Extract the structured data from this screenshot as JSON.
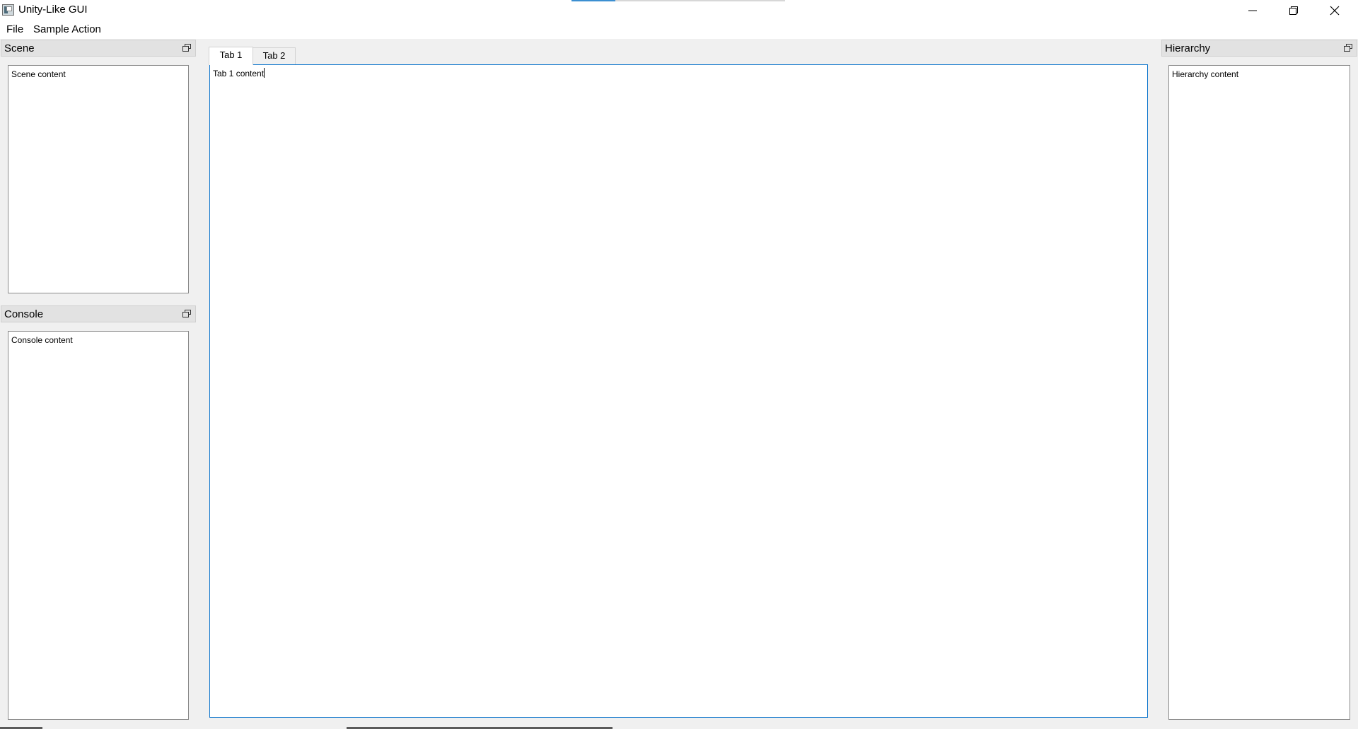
{
  "window": {
    "title": "Unity-Like GUI",
    "icon": "app-icon",
    "controls": [
      "minimize-icon",
      "restore-icon",
      "close-icon"
    ]
  },
  "menubar": {
    "items": [
      {
        "label": "File"
      },
      {
        "label": "Sample Action"
      }
    ]
  },
  "docks": {
    "scene": {
      "title": "Scene",
      "content": "Scene content",
      "float_icon": "float-window-icon"
    },
    "console": {
      "title": "Console",
      "content": "Console content",
      "float_icon": "float-window-icon"
    },
    "hierarchy": {
      "title": "Hierarchy",
      "content": "Hierarchy content",
      "float_icon": "float-window-icon"
    }
  },
  "tabs": {
    "items": [
      {
        "label": "Tab 1",
        "active": true
      },
      {
        "label": "Tab 2",
        "active": false
      }
    ],
    "content": "Tab 1 content"
  },
  "colors": {
    "focus_border": "#0b74cc",
    "window_background": "#f0f0f0",
    "dock_header": "#e2e2e2"
  }
}
